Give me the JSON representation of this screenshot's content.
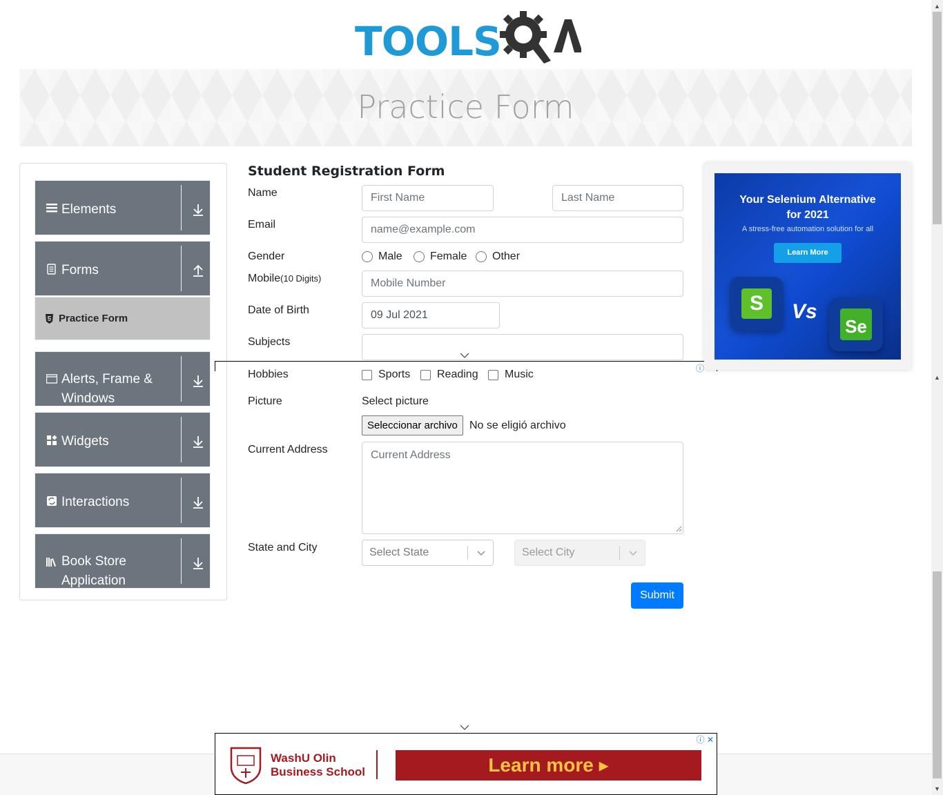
{
  "header": {
    "logo_text": "TOOLS",
    "logo_qa": "QA"
  },
  "banner": {
    "title": "Practice Form"
  },
  "sidebar": {
    "groups": [
      {
        "label": "Elements",
        "icon": "hamburger-icon"
      },
      {
        "label": "Forms",
        "icon": "document-icon"
      },
      {
        "label": "Alerts, Frame & Windows",
        "icon": "window-icon"
      },
      {
        "label": "Widgets",
        "icon": "widgets-icon"
      },
      {
        "label": "Interactions",
        "icon": "interactions-icon"
      },
      {
        "label": "Book Store Application",
        "icon": "books-icon"
      }
    ],
    "active_item": "Practice Form"
  },
  "form": {
    "title": "Student Registration Form",
    "labels": {
      "name": "Name",
      "email": "Email",
      "gender": "Gender",
      "mobile": "Mobile",
      "mobile_hint": "(10 Digits)",
      "dob": "Date of Birth",
      "subjects": "Subjects",
      "hobbies": "Hobbies",
      "picture": "Picture",
      "address": "Current Address",
      "state_city": "State and City"
    },
    "placeholders": {
      "first_name": "First Name",
      "last_name": "Last Name",
      "email": "name@example.com",
      "mobile": "Mobile Number",
      "address": "Current Address"
    },
    "dob_value": "09 Jul 2021",
    "genders": [
      "Male",
      "Female",
      "Other"
    ],
    "hobbies": [
      "Sports",
      "Reading",
      "Music"
    ],
    "picture_label": "Select picture",
    "file_button": "Seleccionar archivo",
    "file_status": "No se eligió archivo",
    "state_placeholder": "Select State",
    "city_placeholder": "Select City",
    "submit": "Submit"
  },
  "right_ad": {
    "headline": "Your Selenium Alternative for 2021",
    "subline": "A stress-free automation solution for all",
    "button": "Learn More",
    "vs": "Vs",
    "left_logo": "S",
    "right_logo": "Se"
  },
  "bottom_ad": {
    "school_line1": "WashU Olin",
    "school_line2": "Business School",
    "cta": "Learn more ▸"
  },
  "colors": {
    "primary": "#007bff",
    "sidebar": "#6c757d",
    "logo_blue": "#1f9ad6",
    "ad_red": "#a41a1f"
  }
}
